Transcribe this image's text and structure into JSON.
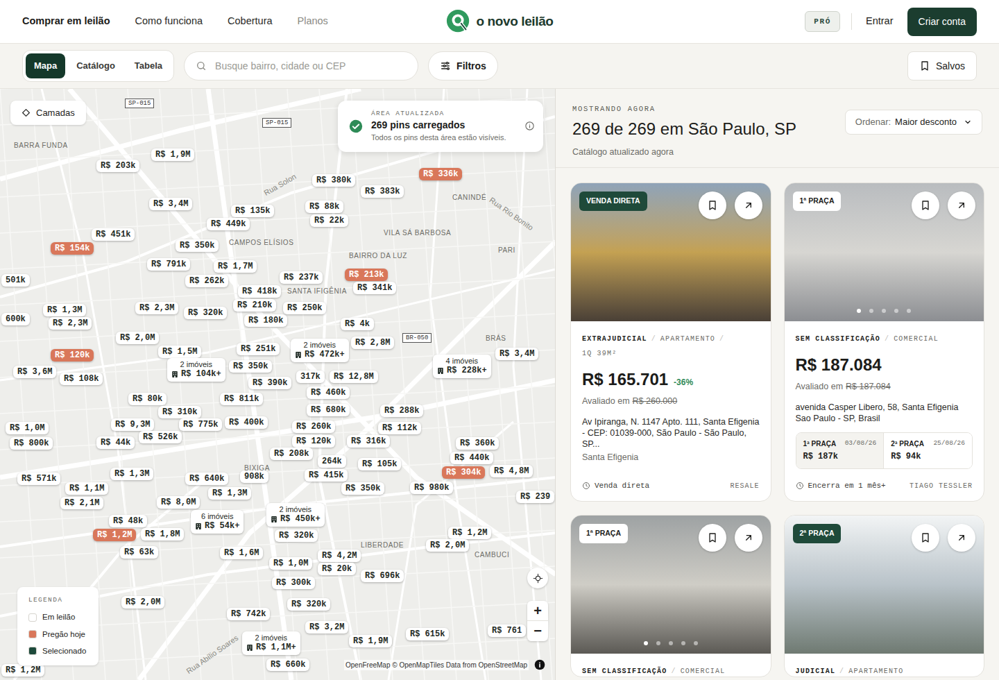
{
  "header": {
    "nav": [
      {
        "label": "Comprar em leilão",
        "active": true,
        "muted": false
      },
      {
        "label": "Como funciona",
        "active": false,
        "muted": false
      },
      {
        "label": "Cobertura",
        "active": false,
        "muted": false
      },
      {
        "label": "Planos",
        "active": false,
        "muted": true
      }
    ],
    "logo": "o novo leilão",
    "pro_badge": "PRÓ",
    "login": "Entrar",
    "signup": "Criar conta"
  },
  "toolbar": {
    "views": [
      {
        "label": "Mapa",
        "selected": true
      },
      {
        "label": "Catálogo",
        "selected": false
      },
      {
        "label": "Tabela",
        "selected": false
      }
    ],
    "search": {
      "placeholder": "Busque bairro, cidade ou CEP"
    },
    "filters": "Filtros",
    "saved": "Salvos"
  },
  "map": {
    "layers_button": "Camadas",
    "toast": {
      "eyebrow": "ÁREA ATUALIZADA",
      "title": "269 pins carregados",
      "text": "Todos os pins desta área estão visíveis."
    },
    "place_labels": [
      "BARRA FUNDA",
      "CAMPOS ELÍSIOS",
      "SANTA IFIGÊNIA",
      "BAIRRO DA LUZ",
      "VILA SÁ BARBOSA",
      "CANINDÉ",
      "PARI",
      "BRÁS",
      "BIXIGA",
      "LIBERDADE",
      "CAMBUCI"
    ],
    "street_labels": [
      "Rua Solon",
      "Rua Rio Bonito",
      "Rua Abílio Soares"
    ],
    "road_shields": [
      "SP-015",
      "SP-015",
      "BR-050"
    ],
    "pins": [
      {
        "label": "R$ 1,9M",
        "kind": "price"
      },
      {
        "label": "R$ 203k",
        "kind": "price"
      },
      {
        "label": "R$ 3,4M",
        "kind": "price"
      },
      {
        "label": "R$ 135k",
        "kind": "price"
      },
      {
        "label": "R$ 449k",
        "kind": "price"
      },
      {
        "label": "R$ 451k",
        "kind": "price"
      },
      {
        "label": "R$ 350k",
        "kind": "price"
      },
      {
        "label": "R$ 154k",
        "kind": "today"
      },
      {
        "label": "R$ 791k",
        "kind": "price"
      },
      {
        "label": "R$ 1,7M",
        "kind": "price"
      },
      {
        "label": "R$ 262k",
        "kind": "price"
      },
      {
        "label": "R$ 418k",
        "kind": "price"
      },
      {
        "label": "501k",
        "kind": "price"
      },
      {
        "label": "R$ 237k",
        "kind": "price"
      },
      {
        "label": "R$ 213k",
        "kind": "today"
      },
      {
        "label": "R$ 341k",
        "kind": "price"
      },
      {
        "label": "R$ 380k",
        "kind": "price"
      },
      {
        "label": "R$ 383k",
        "kind": "price"
      },
      {
        "label": "R$ 336k",
        "kind": "today"
      },
      {
        "label": "R$ 88k",
        "kind": "price"
      },
      {
        "label": "R$ 22k",
        "kind": "price"
      },
      {
        "label": "R$ 1,3M",
        "kind": "price"
      },
      {
        "label": "R$ 2,3M",
        "kind": "price"
      },
      {
        "label": "600k",
        "kind": "price"
      },
      {
        "label": "R$ 2,3M",
        "kind": "price"
      },
      {
        "label": "R$ 320k",
        "kind": "price"
      },
      {
        "label": "R$ 210k",
        "kind": "price"
      },
      {
        "label": "R$ 180k",
        "kind": "price"
      },
      {
        "label": "R$ 250k",
        "kind": "price"
      },
      {
        "label": "R$ 4k",
        "kind": "price"
      },
      {
        "label": "R$ 2,0M",
        "kind": "price"
      },
      {
        "label": "R$ 2,8M",
        "kind": "price"
      },
      {
        "label": "R$ 120k",
        "kind": "today"
      },
      {
        "label": "R$ 1,5M",
        "kind": "price"
      },
      {
        "label": "R$ 251k",
        "kind": "price"
      },
      {
        "label": "R$ 3,6M",
        "kind": "price"
      },
      {
        "label": "R$ 108k",
        "kind": "price"
      },
      {
        "label": "R$ 350k",
        "kind": "price"
      },
      {
        "label": "R$ 390k",
        "kind": "price"
      },
      {
        "label": "317k",
        "kind": "price"
      },
      {
        "label": "R$ 12,8M",
        "kind": "price"
      },
      {
        "label": "R$ 3,4M",
        "kind": "price"
      },
      {
        "label": "R$ 80k",
        "kind": "price"
      },
      {
        "label": "R$ 811k",
        "kind": "price"
      },
      {
        "label": "R$ 460k",
        "kind": "price"
      },
      {
        "label": "R$ 310k",
        "kind": "price"
      },
      {
        "label": "R$ 680k",
        "kind": "price"
      },
      {
        "label": "R$ 288k",
        "kind": "price"
      },
      {
        "label": "R$ 9,3M",
        "kind": "price"
      },
      {
        "label": "R$ 775k",
        "kind": "price"
      },
      {
        "label": "R$ 400k",
        "kind": "price"
      },
      {
        "label": "R$ 112k",
        "kind": "price"
      },
      {
        "label": "R$ 260k",
        "kind": "price"
      },
      {
        "label": "R$ 526k",
        "kind": "price"
      },
      {
        "label": "R$ 1,0M",
        "kind": "price"
      },
      {
        "label": "R$ 800k",
        "kind": "price"
      },
      {
        "label": "R$ 44k",
        "kind": "price"
      },
      {
        "label": "R$ 120k",
        "kind": "price"
      },
      {
        "label": "R$ 316k",
        "kind": "price"
      },
      {
        "label": "R$ 360k",
        "kind": "price"
      },
      {
        "label": "R$ 208k",
        "kind": "price"
      },
      {
        "label": "R$ 440k",
        "kind": "price"
      },
      {
        "label": "264k",
        "kind": "price"
      },
      {
        "label": "R$ 105k",
        "kind": "price"
      },
      {
        "label": "R$ 304k",
        "kind": "today"
      },
      {
        "label": "R$ 4,8M",
        "kind": "price"
      },
      {
        "label": "R$ 1,3M",
        "kind": "price"
      },
      {
        "label": "R$ 640k",
        "kind": "price"
      },
      {
        "label": "908k",
        "kind": "price"
      },
      {
        "label": "R$ 415k",
        "kind": "price"
      },
      {
        "label": "R$ 571k",
        "kind": "price"
      },
      {
        "label": "R$ 1,1M",
        "kind": "price"
      },
      {
        "label": "R$ 350k",
        "kind": "price"
      },
      {
        "label": "R$ 980k",
        "kind": "price"
      },
      {
        "label": "R$ 239",
        "kind": "price"
      },
      {
        "label": "R$ 1,3M",
        "kind": "price"
      },
      {
        "label": "R$ 2,1M",
        "kind": "price"
      },
      {
        "label": "R$ 8,0M",
        "kind": "price"
      },
      {
        "label": "R$ 48k",
        "kind": "price"
      },
      {
        "label": "R$ 1,8M",
        "kind": "price"
      },
      {
        "label": "R$ 320k",
        "kind": "price"
      },
      {
        "label": "R$ 1,2M",
        "kind": "today"
      },
      {
        "label": "R$ 1,2M",
        "kind": "price"
      },
      {
        "label": "R$ 2,0M",
        "kind": "price"
      },
      {
        "label": "R$ 63k",
        "kind": "price"
      },
      {
        "label": "R$ 1,6M",
        "kind": "price"
      },
      {
        "label": "R$ 4,2M",
        "kind": "price"
      },
      {
        "label": "R$ 1,0M",
        "kind": "price"
      },
      {
        "label": "R$ 20k",
        "kind": "price"
      },
      {
        "label": "R$ 696k",
        "kind": "price"
      },
      {
        "label": "R$ 300k",
        "kind": "price"
      },
      {
        "label": "R$ 2,0M",
        "kind": "price"
      },
      {
        "label": "R$ 320k",
        "kind": "price"
      },
      {
        "label": "R$ 742k",
        "kind": "price"
      },
      {
        "label": "R$ 3,2M",
        "kind": "price"
      },
      {
        "label": "R$ 1,9M",
        "kind": "price"
      },
      {
        "label": "R$ 615k",
        "kind": "price"
      },
      {
        "label": "R$ 761",
        "kind": "price"
      },
      {
        "label": "R$ 660k",
        "kind": "price"
      },
      {
        "label": "R$ 1,2M",
        "kind": "price"
      },
      {
        "label": "R$ 472k+",
        "count": "2 imóveis",
        "kind": "group"
      },
      {
        "label": "R$ 104k+",
        "count": "2 imóveis",
        "kind": "group"
      },
      {
        "label": "R$ 228k+",
        "count": "4 imóveis",
        "kind": "group"
      },
      {
        "label": "R$ 450k+",
        "count": "2 imóveis",
        "kind": "group"
      },
      {
        "label": "R$ 54k+",
        "count": "6 imóveis",
        "kind": "group"
      },
      {
        "label": "R$ 1,1M+",
        "count": "2 imóveis",
        "kind": "group"
      }
    ],
    "legend": {
      "title": "LEGENDA",
      "items": [
        {
          "label": "Em leilão",
          "color": "#ffffff"
        },
        {
          "label": "Pregão hoje",
          "color": "#d9775a"
        },
        {
          "label": "Selecionado",
          "color": "#1d4a3b"
        }
      ]
    },
    "zoom_in": "+",
    "zoom_out": "−",
    "attribution": "OpenFreeMap © OpenMapTiles Data from OpenStreetMap"
  },
  "results": {
    "eyebrow": "MOSTRANDO AGORA",
    "title": "269 de 269 em São Paulo, SP",
    "subtitle": "Catálogo atualizado agora",
    "sort": {
      "label": "Ordenar:",
      "value": "Maior desconto"
    },
    "tag_separator": "/",
    "cards": [
      {
        "badge": {
          "label": "VENDA DIRETA",
          "kind": "dark"
        },
        "dots": [],
        "tags": [
          "EXTRAJUDICIAL",
          "APARTAMENTO",
          "1Q 39M²"
        ],
        "price": "R$ 165.701",
        "discount": "-36%",
        "appraisal_label": "Avaliado em",
        "appraisal": "R$ 260.000",
        "address": "Av Ipiranga, N. 1147 Apto. 111, Santa Efigenia - CEP: 01039-000, São Paulo - São Paulo, SP...",
        "district": "Santa Efigenia",
        "rounds": [],
        "status": "Venda direta",
        "source": "RESALE"
      },
      {
        "badge": {
          "label": "1ª PRAÇA",
          "kind": "light"
        },
        "dots": [
          {
            "selected": true
          },
          {
            "selected": false
          },
          {
            "selected": false
          },
          {
            "selected": false
          },
          {
            "selected": false
          }
        ],
        "tags": [
          "SEM CLASSIFICAÇÃO",
          "COMERCIAL"
        ],
        "price": "R$ 187.084",
        "discount": "",
        "appraisal_label": "Avaliado em",
        "appraisal": "R$ 187.084",
        "address": "avenida Casper Libero, 58, Santa Efigenia Sao Paulo - SP, Brasil",
        "district": "",
        "rounds": [
          {
            "label": "1ª PRAÇA",
            "date": "03/08/26",
            "value": "R$ 187k"
          },
          {
            "label": "2ª PRAÇA",
            "date": "25/08/26",
            "value": "R$ 94k"
          }
        ],
        "status": "Encerra em 1 mês+",
        "source": "TIAGO TESSLER"
      },
      {
        "badge": {
          "label": "1ª PRAÇA",
          "kind": "light"
        },
        "dots": [
          {
            "selected": true
          },
          {
            "selected": false
          },
          {
            "selected": false
          },
          {
            "selected": false
          },
          {
            "selected": false
          }
        ],
        "tags": [
          "SEM CLASSIFICAÇÃO",
          "COMERCIAL"
        ]
      },
      {
        "badge": {
          "label": "2ª PRAÇA",
          "kind": "dark"
        },
        "dots": [],
        "tags": [
          "JUDICIAL",
          "APARTAMENTO"
        ]
      }
    ]
  }
}
